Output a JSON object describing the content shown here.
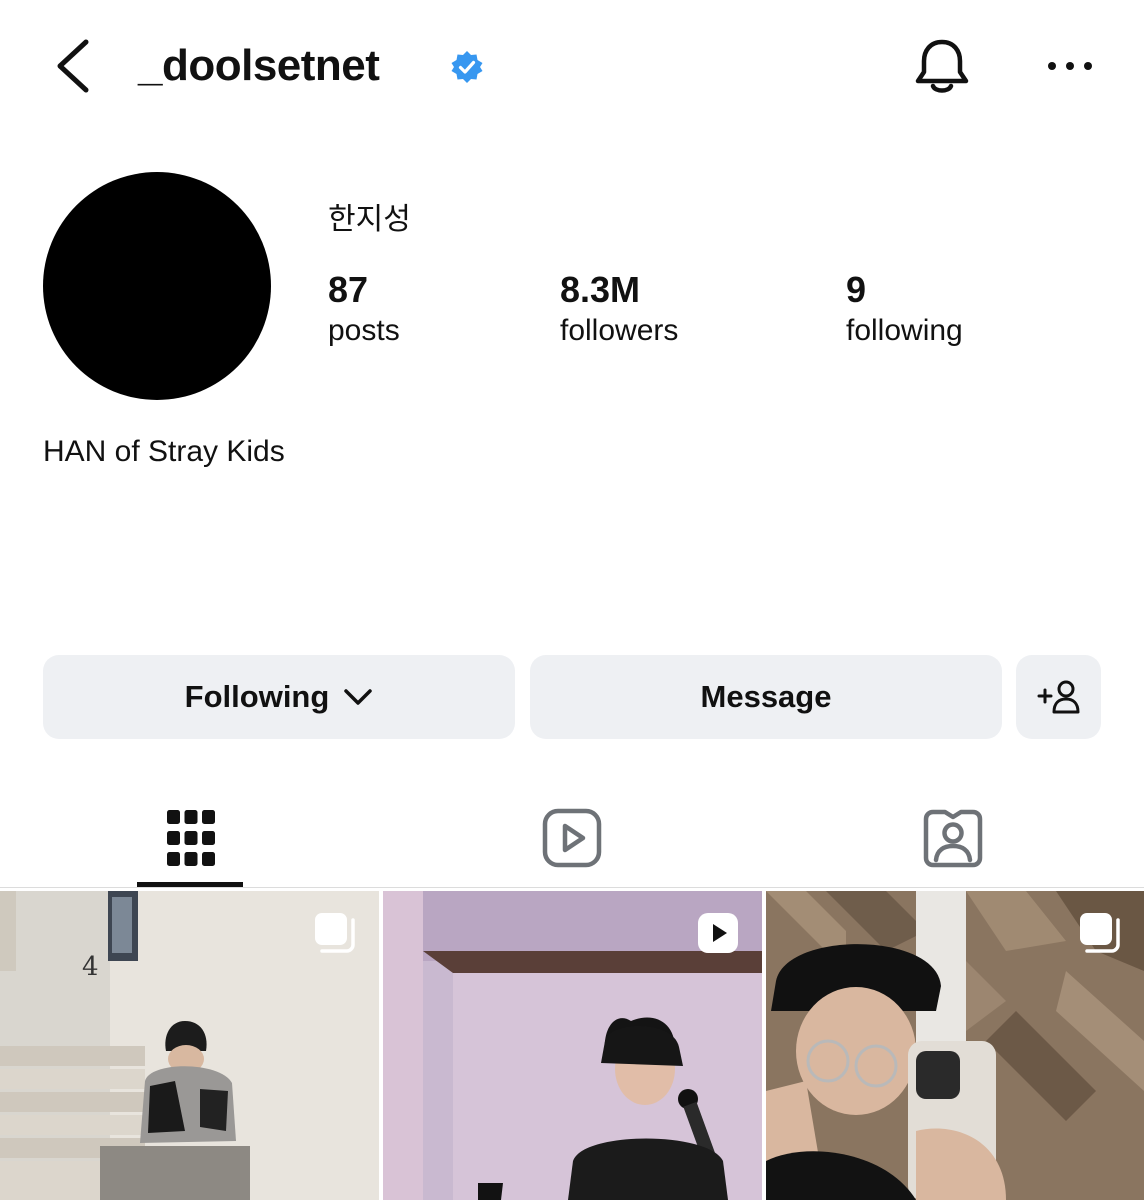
{
  "header": {
    "username": "_doolsetnet",
    "back_icon": "chevron-left-icon",
    "verified_icon": "verified-badge-icon",
    "notifications_icon": "bell-icon",
    "more_icon": "more-horizontal-icon"
  },
  "profile": {
    "display_name": "한지성",
    "bio": "HAN of Stray Kids",
    "avatar_color": "#000000"
  },
  "stats": {
    "posts": {
      "value": "87",
      "label": "posts"
    },
    "followers": {
      "value": "8.3M",
      "label": "followers"
    },
    "following": {
      "value": "9",
      "label": "following"
    }
  },
  "actions": {
    "following_label": "Following",
    "message_label": "Message",
    "add_icon": "person-add-icon"
  },
  "tabs": [
    {
      "name": "posts-grid",
      "icon": "grid-icon",
      "active": true
    },
    {
      "name": "reels",
      "icon": "reels-icon",
      "active": false
    },
    {
      "name": "tagged",
      "icon": "tagged-person-icon",
      "active": false
    }
  ],
  "posts": [
    {
      "type": "carousel",
      "badge_icon": "carousel-icon"
    },
    {
      "type": "reel",
      "badge_icon": "reel-play-icon"
    },
    {
      "type": "carousel",
      "badge_icon": "carousel-icon"
    }
  ],
  "colors": {
    "verified": "#3797f0",
    "button_bg": "#eef0f3",
    "text": "#111111",
    "tab_inactive": "#6e7277"
  }
}
